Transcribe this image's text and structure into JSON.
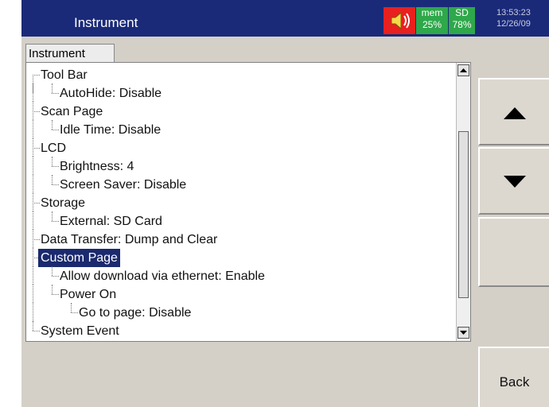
{
  "header": {
    "title": "Instrument",
    "speaker_icon": "speaker-icon",
    "mem_label": "mem",
    "mem_value": "25%",
    "sd_label": "SD",
    "sd_value": "78%",
    "time": "13:53:23",
    "date": "12/26/09"
  },
  "tab": {
    "label": "Instrument"
  },
  "tree": {
    "items": [
      {
        "label": "Tool Bar",
        "level": 0
      },
      {
        "label": "AutoHide: Disable",
        "level": 1
      },
      {
        "label": "Scan Page",
        "level": 0
      },
      {
        "label": "Idle Time: Disable",
        "level": 1
      },
      {
        "label": "LCD",
        "level": 0
      },
      {
        "label": "Brightness: 4",
        "level": 1
      },
      {
        "label": "Screen Saver: Disable",
        "level": 1
      },
      {
        "label": "Storage",
        "level": 0
      },
      {
        "label": "External: SD Card",
        "level": 1
      },
      {
        "label": "Data Transfer: Dump and Clear",
        "level": 0
      },
      {
        "label": "Custom Page",
        "level": 0,
        "selected": true
      },
      {
        "label": "Allow download via ethernet: Enable",
        "level": 1
      },
      {
        "label": "Power On",
        "level": 1
      },
      {
        "label": "Go to page: Disable",
        "level": 2
      },
      {
        "label": "System Event",
        "level": 0
      }
    ]
  },
  "scrollbar": {
    "up_icon": "scroll-up-arrow-icon",
    "down_icon": "scroll-down-arrow-icon"
  },
  "side_buttons": {
    "up_icon": "arrow-up-icon",
    "down_icon": "arrow-down-icon",
    "back_label": "Back"
  },
  "colors": {
    "titlebar": "#1a2a78",
    "speaker_bg": "#e82020",
    "status_bg": "#2ea84a",
    "selection": "#1b2a6e",
    "panel_bg": "#d4d0c8"
  }
}
